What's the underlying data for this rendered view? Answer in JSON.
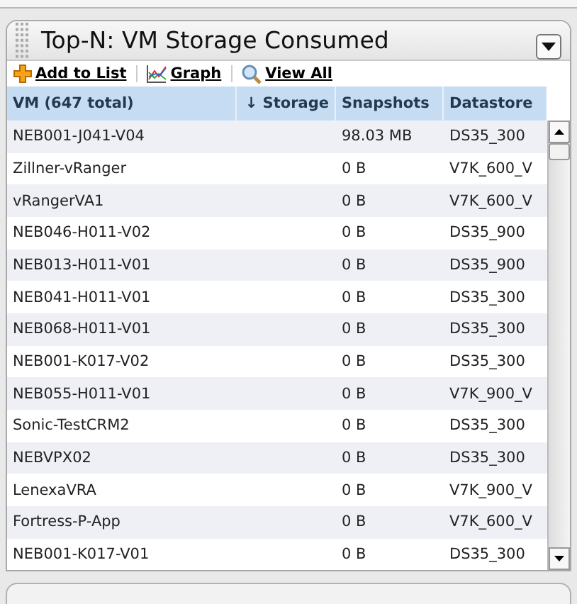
{
  "panel": {
    "title": "Top-N: VM Storage Consumed"
  },
  "toolbar": [
    {
      "kind": "add",
      "label": "Add to List"
    },
    {
      "kind": "graph",
      "label": "Graph"
    },
    {
      "kind": "search",
      "label": "View All"
    }
  ],
  "table": {
    "columns": [
      {
        "label": "VM (647 total)"
      },
      {
        "label": "↓ Storage"
      },
      {
        "label": "Snapshots"
      },
      {
        "label": "Datastore"
      }
    ],
    "rows": [
      {
        "vm": "NEB001-J041-V04",
        "snapshots": "98.03 MB",
        "datastore": "DS35_300"
      },
      {
        "vm": "Zillner-vRanger",
        "snapshots": "0 B",
        "datastore": "V7K_600_V"
      },
      {
        "vm": "vRangerVA1",
        "snapshots": "0 B",
        "datastore": "V7K_600_V"
      },
      {
        "vm": "NEB046-H011-V02",
        "snapshots": "0 B",
        "datastore": "DS35_900"
      },
      {
        "vm": "NEB013-H011-V01",
        "snapshots": "0 B",
        "datastore": "DS35_900"
      },
      {
        "vm": "NEB041-H011-V01",
        "snapshots": "0 B",
        "datastore": "DS35_300"
      },
      {
        "vm": "NEB068-H011-V01",
        "snapshots": "0 B",
        "datastore": "DS35_300"
      },
      {
        "vm": "NEB001-K017-V02",
        "snapshots": "0 B",
        "datastore": "DS35_300"
      },
      {
        "vm": "NEB055-H011-V01",
        "snapshots": "0 B",
        "datastore": "V7K_900_V"
      },
      {
        "vm": "Sonic-TestCRM2",
        "snapshots": "0 B",
        "datastore": "DS35_300"
      },
      {
        "vm": "NEBVPX02",
        "snapshots": "0 B",
        "datastore": "DS35_300"
      },
      {
        "vm": "LenexaVRA",
        "snapshots": "0 B",
        "datastore": "V7K_900_V"
      },
      {
        "vm": "Fortress-P-App",
        "snapshots": "0 B",
        "datastore": "V7K_600_V"
      },
      {
        "vm": "NEB001-K017-V01",
        "snapshots": "0 B",
        "datastore": "DS35_300"
      }
    ]
  }
}
